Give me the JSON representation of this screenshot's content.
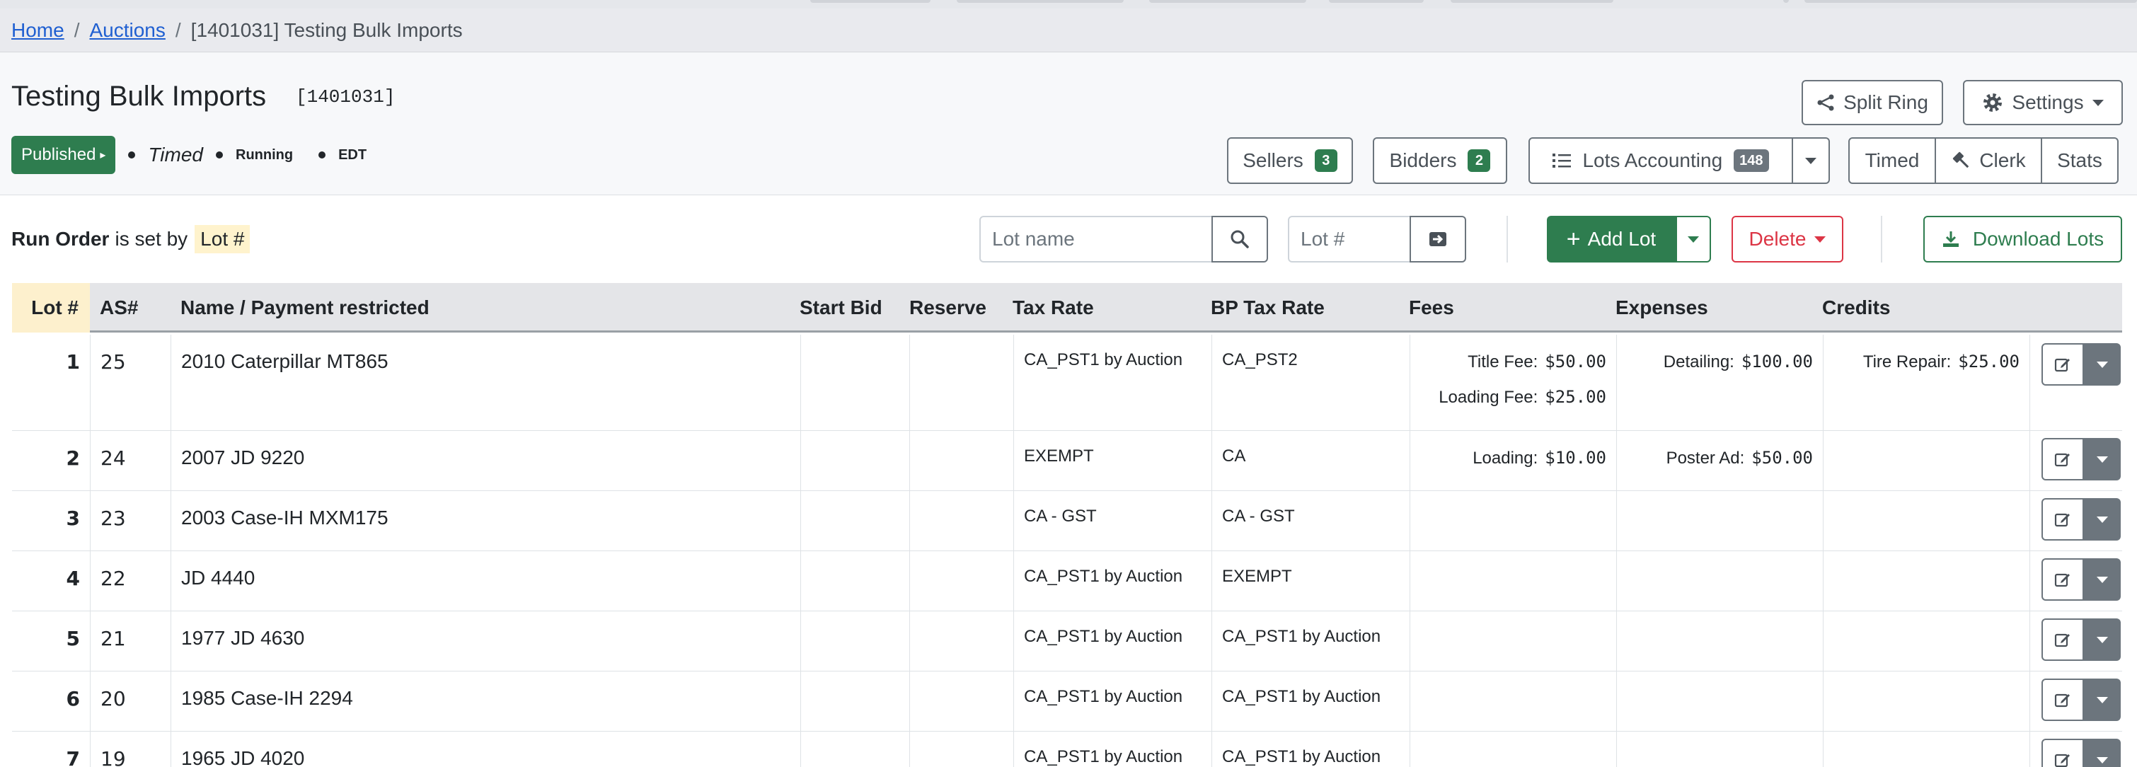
{
  "breadcrumb": {
    "home": "Home",
    "auctions": "Auctions",
    "sep": "/",
    "current": "[1401031] Testing Bulk Imports"
  },
  "header": {
    "title": "Testing Bulk Imports",
    "auction_id": "[1401031]",
    "status_button": "Published",
    "status_timed": "Timed",
    "status_running": "Running",
    "status_tz": "EDT"
  },
  "actions": {
    "split_ring": "Split Ring",
    "settings": "Settings",
    "sellers": "Sellers",
    "sellers_count": "3",
    "bidders": "Bidders",
    "bidders_count": "2",
    "lots_accounting": "Lots Accounting",
    "lots_accounting_count": "148",
    "timed": "Timed",
    "clerk": "Clerk",
    "stats": "Stats"
  },
  "toolbar": {
    "run_order_bold": "Run Order",
    "run_order_text": "is set by",
    "run_order_key": "Lot #",
    "lot_name_placeholder": "Lot name",
    "lot_number_placeholder": "Lot #",
    "add_lot": "Add Lot",
    "delete": "Delete",
    "download": "Download Lots"
  },
  "table": {
    "columns": [
      "Lot #",
      "AS#",
      "Name / Payment restricted",
      "Start Bid",
      "Reserve",
      "Tax Rate",
      "BP Tax Rate",
      "Fees",
      "Expenses",
      "Credits"
    ],
    "rows": [
      {
        "lot": "1",
        "as": "25",
        "name": "2010 Caterpillar MT865",
        "tax": "CA_PST1 by Auction",
        "bp_tax": "CA_PST2",
        "fees": [
          {
            "label": "Title Fee:",
            "value": "$50.00"
          },
          {
            "label": "Loading Fee:",
            "value": "$25.00"
          }
        ],
        "expenses": [
          {
            "label": "Detailing:",
            "value": "$100.00"
          }
        ],
        "credits": [
          {
            "label": "Tire Repair:",
            "value": "$25.00"
          }
        ]
      },
      {
        "lot": "2",
        "as": "24",
        "name": "2007 JD 9220",
        "tax": "EXEMPT",
        "bp_tax": "CA",
        "fees": [
          {
            "label": "Loading:",
            "value": "$10.00"
          }
        ],
        "expenses": [
          {
            "label": "Poster Ad:",
            "value": "$50.00"
          }
        ],
        "credits": []
      },
      {
        "lot": "3",
        "as": "23",
        "name": "2003 Case-IH MXM175",
        "tax": "CA - GST",
        "bp_tax": "CA - GST",
        "fees": [],
        "expenses": [],
        "credits": []
      },
      {
        "lot": "4",
        "as": "22",
        "name": "JD 4440",
        "tax": "CA_PST1 by Auction",
        "bp_tax": "EXEMPT",
        "fees": [],
        "expenses": [],
        "credits": []
      },
      {
        "lot": "5",
        "as": "21",
        "name": "1977 JD 4630",
        "tax": "CA_PST1 by Auction",
        "bp_tax": "CA_PST1 by Auction",
        "fees": [],
        "expenses": [],
        "credits": []
      },
      {
        "lot": "6",
        "as": "20",
        "name": "1985 Case-IH 2294",
        "tax": "CA_PST1 by Auction",
        "bp_tax": "CA_PST1 by Auction",
        "fees": [],
        "expenses": [],
        "credits": []
      },
      {
        "lot": "7",
        "as": "19",
        "name": "1965 JD 4020",
        "tax": "CA_PST1 by Auction",
        "bp_tax": "CA_PST1 by Auction",
        "fees": [],
        "expenses": [],
        "credits": []
      }
    ]
  },
  "icons": {
    "split_ring": "share-icon",
    "settings": "gear-icon",
    "lots_accounting": "list-icon",
    "clerk": "gavel-icon",
    "search": "search-icon",
    "go": "arrow-right-icon",
    "add": "plus-icon",
    "download": "download-icon",
    "edit": "edit-icon"
  },
  "colors": {
    "primary_green": "#2e7d4f",
    "danger_red": "#dc3545",
    "link_blue": "#1f5fd1",
    "highlight_yellow": "#fff3cd"
  }
}
